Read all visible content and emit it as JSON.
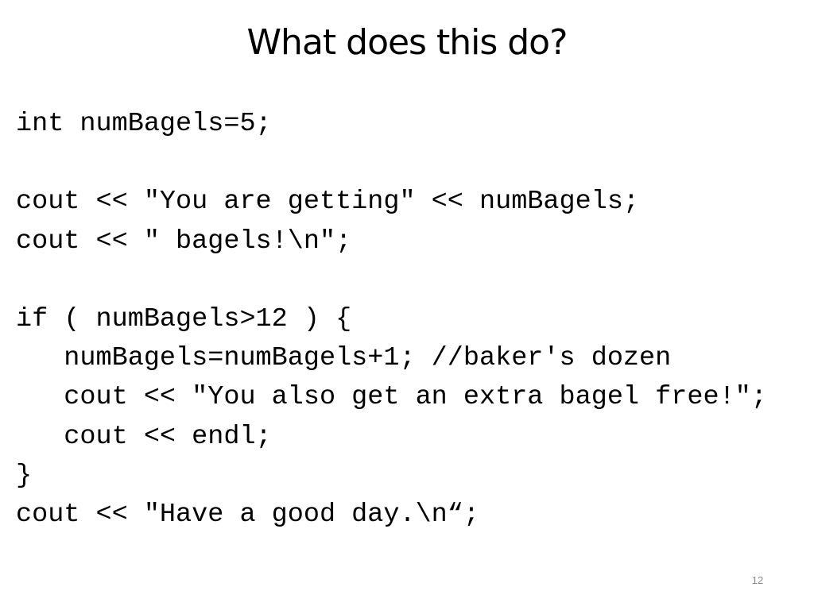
{
  "slide": {
    "title": "What does this do?",
    "code_lines": [
      "int numBagels=5;",
      "",
      "cout << \"You are getting\" << numBagels;",
      "cout << \" bagels!\\n\";",
      "",
      "if ( numBagels>12 ) {",
      "   numBagels=numBagels+1; //baker's dozen",
      "   cout << \"You also get an extra bagel free!\";",
      "   cout << endl;",
      "}",
      "cout << \"Have a good day.\\n“;"
    ],
    "page_number": "12"
  }
}
